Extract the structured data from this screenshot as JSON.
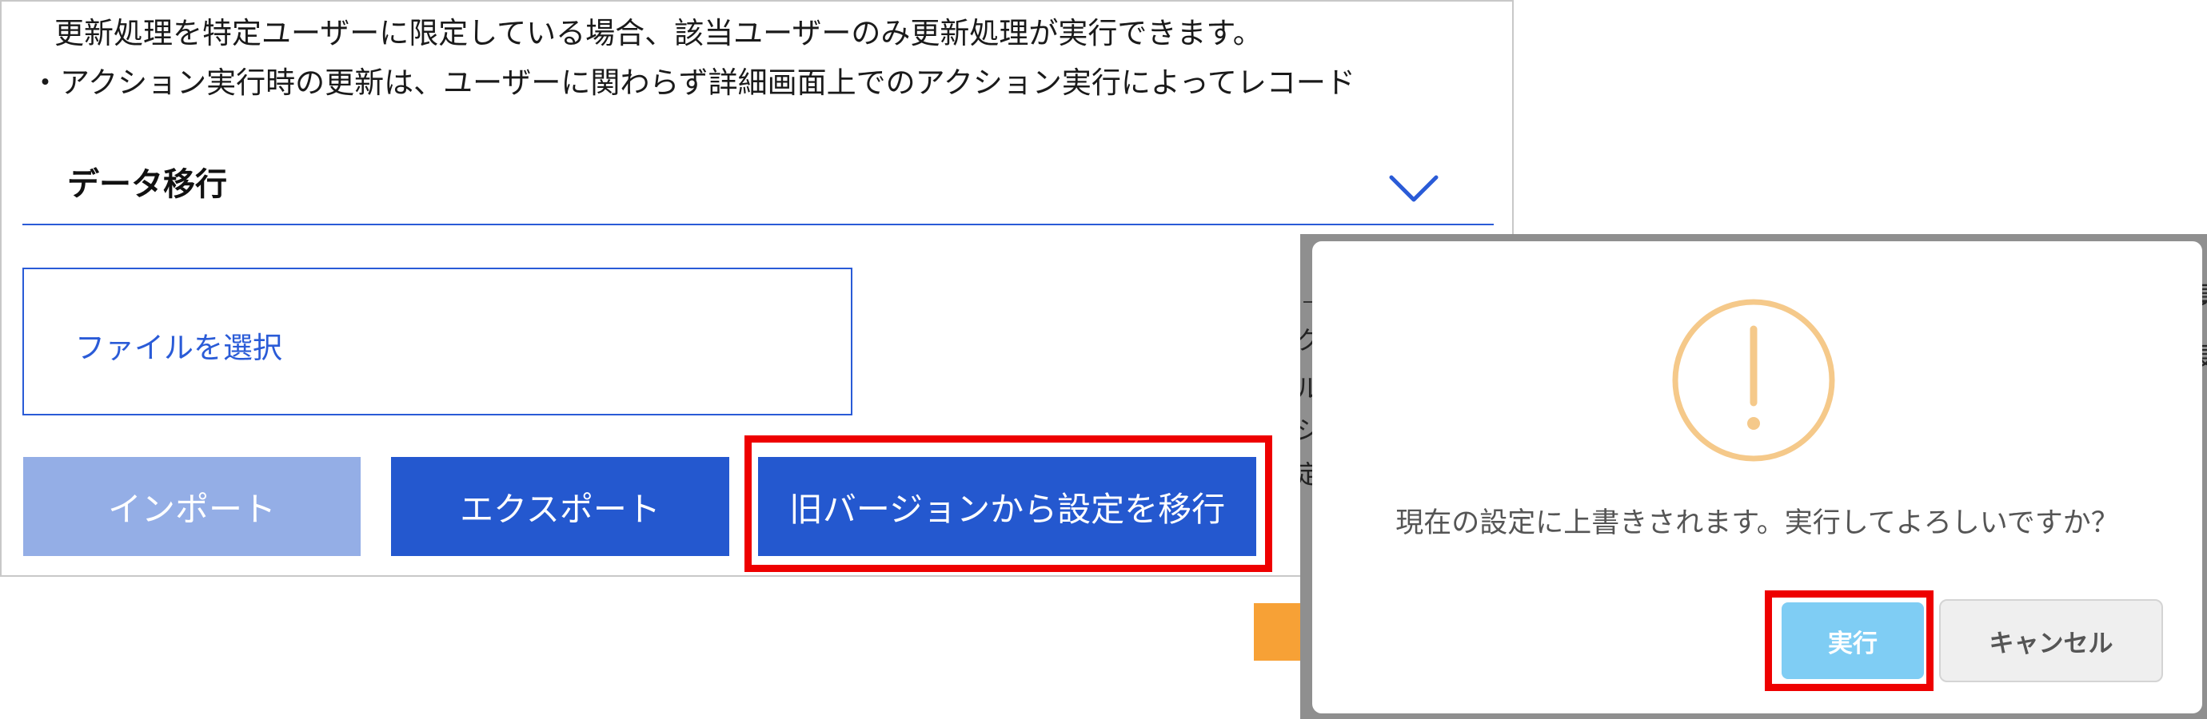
{
  "settings_panel": {
    "description_lines": [
      "更新処理を特定ユーザーに限定している場合、該当ユーザーのみ更新処理が実行できます。",
      "・アクション実行時の更新は、ユーザーに関わらず詳細画面上でのアクション実行によってレコード"
    ],
    "section": {
      "title": "データ移行",
      "toggle_icon": "chevron-down-icon"
    },
    "file_select_label": "ファイルを選択",
    "buttons": {
      "import": "インポート",
      "export": "エクスポート",
      "migrate": "旧バージョンから設定を移行"
    }
  },
  "dialog": {
    "icon": "warning-icon",
    "message": "現在の設定に上書きされます。実行してよろしいですか？",
    "execute_label": "実行",
    "cancel_label": "キャンセル"
  },
  "backdrop_fragments": [
    "ク",
    "ル",
    "ジ",
    "定",
    "頁",
    "更"
  ],
  "colors": {
    "primary": "#2458cf",
    "primary_disabled": "#94aee6",
    "link": "#2a5bd7",
    "highlight": "#ee0000",
    "arrow": "#f7a136",
    "warning": "#f5c98a",
    "execute": "#7fcdf4",
    "cancel_bg": "#efefef"
  }
}
